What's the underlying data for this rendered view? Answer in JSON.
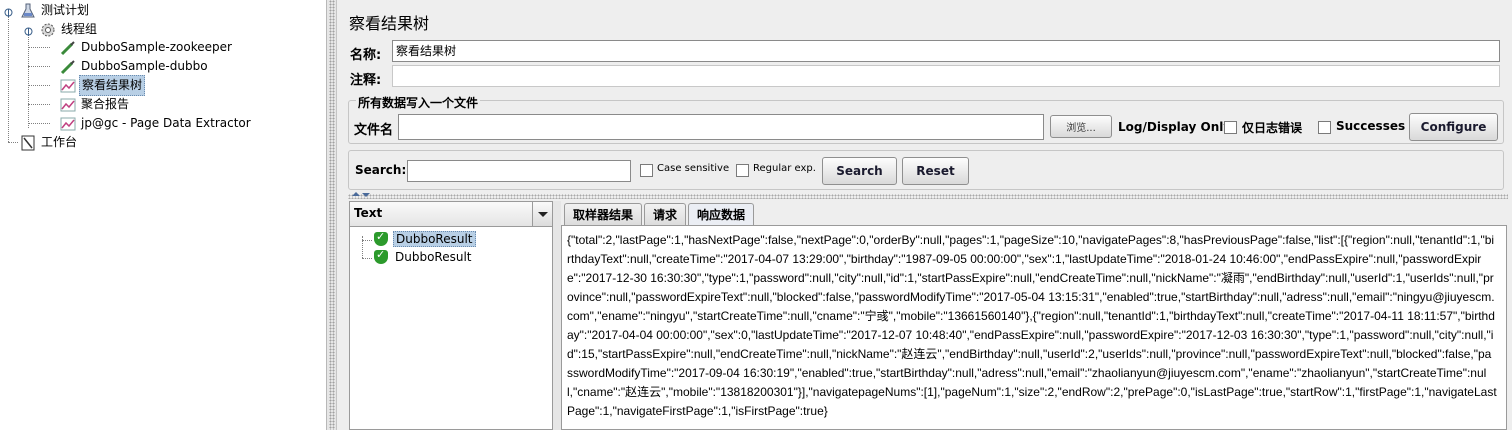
{
  "tree": {
    "items": [
      {
        "label": "测试计划",
        "icon": "flask-icon"
      },
      {
        "label": "线程组",
        "icon": "gear-icon"
      },
      {
        "label": "DubboSample-zookeeper",
        "icon": "pipette-icon"
      },
      {
        "label": "DubboSample-dubbo",
        "icon": "pipette-icon"
      },
      {
        "label": "察看结果树",
        "icon": "graph-icon"
      },
      {
        "label": "聚合报告",
        "icon": "graph-icon"
      },
      {
        "label": "jp@gc - Page Data Extractor",
        "icon": "graph-icon"
      },
      {
        "label": "工作台",
        "icon": "workbench-icon"
      }
    ]
  },
  "panel": {
    "title": "察看结果树",
    "name_label": "名称:",
    "name_value": "察看结果树",
    "comment_label": "注释:",
    "comment_value": ""
  },
  "file_section": {
    "title": "所有数据写入一个文件",
    "filename_label": "文件名",
    "filename_value": "",
    "browse_label": "浏览...",
    "log_display_label": "Log/Display Only:",
    "errors_only_label": "仅日志错误",
    "successes_label": "Successes",
    "configure_label": "Configure"
  },
  "search": {
    "label": "Search:",
    "value": "",
    "case_sensitive_label": "Case sensitive",
    "regex_label": "Regular exp.",
    "search_button": "Search",
    "reset_button": "Reset"
  },
  "results": {
    "renderer": "Text",
    "items": [
      {
        "label": "DubboResult"
      },
      {
        "label": "DubboResult"
      }
    ]
  },
  "tabs": [
    {
      "label": "取样器结果"
    },
    {
      "label": "请求"
    },
    {
      "label": "响应数据"
    }
  ],
  "response_text": "{\"total\":2,\"lastPage\":1,\"hasNextPage\":false,\"nextPage\":0,\"orderBy\":null,\"pages\":1,\"pageSize\":10,\"navigatePages\":8,\"hasPreviousPage\":false,\"list\":[{\"region\":null,\"tenantId\":1,\"birthdayText\":null,\"createTime\":\"2017-04-07 13:29:00\",\"birthday\":\"1987-09-05 00:00:00\",\"sex\":1,\"lastUpdateTime\":\"2018-01-24 10:46:00\",\"endPassExpire\":null,\"passwordExpire\":\"2017-12-30 16:30:30\",\"type\":1,\"password\":null,\"city\":null,\"id\":1,\"startPassExpire\":null,\"endCreateTime\":null,\"nickName\":\"凝雨\",\"endBirthday\":null,\"userId\":1,\"userIds\":null,\"province\":null,\"passwordExpireText\":null,\"blocked\":false,\"passwordModifyTime\":\"2017-05-04 13:15:31\",\"enabled\":true,\"startBirthday\":null,\"adress\":null,\"email\":\"ningyu@jiuyescm.com\",\"ename\":\"ningyu\",\"startCreateTime\":null,\"cname\":\"宁彧\",\"mobile\":\"13661560140\"},{\"region\":null,\"tenantId\":1,\"birthdayText\":null,\"createTime\":\"2017-04-11 18:11:57\",\"birthday\":\"2017-04-04 00:00:00\",\"sex\":0,\"lastUpdateTime\":\"2017-12-07 10:48:40\",\"endPassExpire\":null,\"passwordExpire\":\"2017-12-03 16:30:30\",\"type\":1,\"password\":null,\"city\":null,\"id\":15,\"startPassExpire\":null,\"endCreateTime\":null,\"nickName\":\"赵连云\",\"endBirthday\":null,\"userId\":2,\"userIds\":null,\"province\":null,\"passwordExpireText\":null,\"blocked\":false,\"passwordModifyTime\":\"2017-09-04 16:30:19\",\"enabled\":true,\"startBirthday\":null,\"adress\":null,\"email\":\"zhaolianyun@jiuyescm.com\",\"ename\":\"zhaolianyun\",\"startCreateTime\":null,\"cname\":\"赵连云\",\"mobile\":\"13818200301\"}],\"navigatepageNums\":[1],\"pageNum\":1,\"size\":2,\"endRow\":2,\"prePage\":0,\"isLastPage\":true,\"startRow\":1,\"firstPage\":1,\"navigateLastPage\":1,\"navigateFirstPage\":1,\"isFirstPage\":true}"
}
